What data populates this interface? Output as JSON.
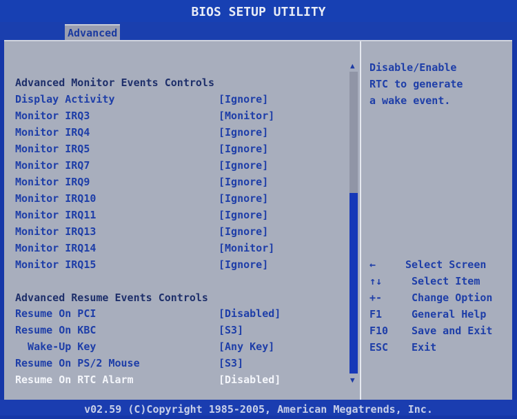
{
  "title": "BIOS SETUP UTILITY",
  "tab": "Advanced",
  "sections": {
    "monitor_header": "Advanced Monitor Events Controls",
    "resume_header": "Advanced Resume Events Controls"
  },
  "rows": [
    {
      "label": "Display Activity",
      "value": "[Ignore]"
    },
    {
      "label": "Monitor IRQ3",
      "value": "[Monitor]"
    },
    {
      "label": "Monitor IRQ4",
      "value": "[Ignore]"
    },
    {
      "label": "Monitor IRQ5",
      "value": "[Ignore]"
    },
    {
      "label": "Monitor IRQ7",
      "value": "[Ignore]"
    },
    {
      "label": "Monitor IRQ9",
      "value": "[Ignore]"
    },
    {
      "label": "Monitor IRQ10",
      "value": "[Ignore]"
    },
    {
      "label": "Monitor IRQ11",
      "value": "[Ignore]"
    },
    {
      "label": "Monitor IRQ13",
      "value": "[Ignore]"
    },
    {
      "label": "Monitor IRQ14",
      "value": "[Monitor]"
    },
    {
      "label": "Monitor IRQ15",
      "value": "[Ignore]"
    }
  ],
  "resume_rows": [
    {
      "label": "Resume On PCI",
      "value": "[Disabled]"
    },
    {
      "label": "Resume On KBC",
      "value": "[S3]"
    },
    {
      "label": "  Wake-Up Key",
      "value": "[Any Key]"
    },
    {
      "label": "Resume On PS/2 Mouse",
      "value": "[S3]"
    },
    {
      "label": "Resume On RTC Alarm",
      "value": "[Disabled]"
    }
  ],
  "help": {
    "line1": "Disable/Enable",
    "line2": "RTC to generate",
    "line3": "a wake event."
  },
  "keys": [
    {
      "key": "←",
      "desc": "Select Screen"
    },
    {
      "key": "↑↓",
      "desc": " Select Item"
    },
    {
      "key": "+-",
      "desc": " Change Option"
    },
    {
      "key": "F1",
      "desc": " General Help"
    },
    {
      "key": "F10",
      "desc": " Save and Exit"
    },
    {
      "key": "ESC",
      "desc": " Exit"
    }
  ],
  "footer": "v02.59 (C)Copyright 1985-2005, American Megatrends, Inc.",
  "colors": {
    "background": "#1637a8",
    "panel": "#a8aebd",
    "text": "#1e3ea8",
    "highlight": "#f4f6fb"
  }
}
